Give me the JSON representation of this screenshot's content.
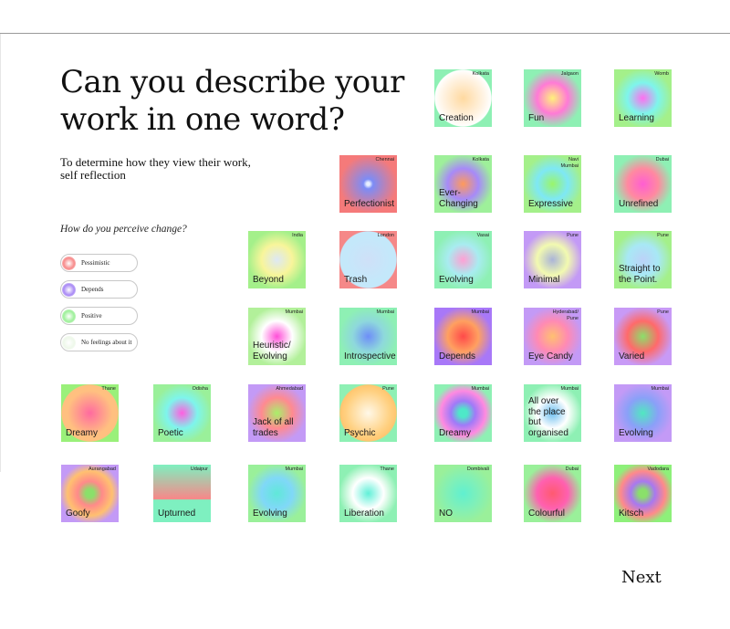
{
  "page": {
    "title": "Can you describe your work in one word?",
    "subtitle": "To determine how they view their work, self reflection",
    "next_label": "Next"
  },
  "legend": {
    "question": "How do you perceive change?",
    "items": [
      {
        "label": "Pessimistic",
        "color": "#f78a8a"
      },
      {
        "label": "Depends",
        "color": "#a98af5"
      },
      {
        "label": "Positive",
        "color": "#9ef09a"
      },
      {
        "label": "No feelings about it",
        "color": "#eef8ea"
      }
    ]
  },
  "tiles": [
    {
      "word": "Creation",
      "city": "Kolkata",
      "bg": "#8ef0b4",
      "center": "#ffd9a0",
      "mid": "#fff6ea",
      "edge": "#ffffff",
      "style": "disc"
    },
    {
      "word": "Fun",
      "city": "Jalgaon",
      "bg": "#8ef0b4",
      "center": "#fff27a",
      "mid": "#ff7ad6",
      "edge": "#8ef0b4",
      "style": "glow"
    },
    {
      "word": "Learning",
      "city": "Womb",
      "bg": "#a4f08a",
      "center": "#ff6ef0",
      "mid": "#7ef5ec",
      "edge": "#a4f08a",
      "style": "glow"
    },
    {
      "word": "Perfectionist",
      "city": "Chennai",
      "bg": "#f57a7a",
      "center": "#e8f0ff",
      "mid": "#7c8cf6",
      "edge": "#f57a7a",
      "style": "dot"
    },
    {
      "word": "Ever-\nChanging",
      "city": "Kolkata",
      "bg": "#9ef09a",
      "center": "#ff9a5a",
      "mid": "#a78af8",
      "edge": "#9ef09a",
      "style": "glow"
    },
    {
      "word": "Expressive",
      "city": "Navi\nMumbai",
      "bg": "#a4f08a",
      "center": "#9af56a",
      "mid": "#7ee8f5",
      "edge": "#a4f08a",
      "style": "glow"
    },
    {
      "word": "Unrefined",
      "city": "Dubai",
      "bg": "#8ef0b4",
      "center": "#ff5ed2",
      "mid": "#ff8aa0",
      "edge": "#8ef0b4",
      "style": "glow"
    },
    {
      "word": "Beyond",
      "city": "India",
      "bg": "#a4f08a",
      "center": "#dde8f5",
      "mid": "#f8f59a",
      "edge": "#a4f08a",
      "style": "glow"
    },
    {
      "word": "Trash",
      "city": "London",
      "bg": "#f58888",
      "center": "#cfe0f8",
      "mid": "#c4e8fa",
      "edge": "#c4e8fa",
      "style": "disc"
    },
    {
      "word": "Evolving",
      "city": "Vasai",
      "bg": "#8ef0b4",
      "center": "#ffa0d4",
      "mid": "#a8ecf0",
      "edge": "#8ef0b4",
      "style": "glow"
    },
    {
      "word": "Minimal",
      "city": "Pune",
      "bg": "#c39af6",
      "center": "#aab4d8",
      "mid": "#f2fab0",
      "edge": "#c39af6",
      "style": "glow"
    },
    {
      "word": "Straight to\nthe Point.",
      "city": "Pune",
      "bg": "#a4f08a",
      "center": "#bcd2f8",
      "mid": "#a8e8f5",
      "edge": "#a4f08a",
      "style": "glow"
    },
    {
      "word": "Heuristic/\nEvolving",
      "city": "Mumbai",
      "bg": "#b2f09a",
      "center": "#ff4ed8",
      "mid": "#ffffff",
      "edge": "#b2f09a",
      "style": "glow"
    },
    {
      "word": "Introspective",
      "city": "Mumbai",
      "bg": "#8ef0b4",
      "center": "#6e8ef8",
      "mid": "#8ed8dc",
      "edge": "#8ef0b4",
      "style": "glow"
    },
    {
      "word": "Depends",
      "city": "Mumbai",
      "bg": "#a878f8",
      "center": "#ff4a4a",
      "mid": "#ffa060",
      "edge": "#a878f8",
      "style": "glow"
    },
    {
      "word": "Eye Candy",
      "city": "Hyderabad/\nPune",
      "bg": "#c39af6",
      "center": "#ffc070",
      "mid": "#ff8ab4",
      "edge": "#c39af6",
      "style": "glow"
    },
    {
      "word": "Varied",
      "city": "Pune",
      "bg": "#c89af6",
      "center": "#8ae06a",
      "mid": "#ff6a6a",
      "edge": "#c89af6",
      "style": "glow"
    },
    {
      "word": "Dreamy",
      "city": "Thane",
      "bg": "#9af07a",
      "center": "#ff6aa0",
      "mid": "#ffc080",
      "edge": "#ffc080",
      "style": "disc"
    },
    {
      "word": "Poetic",
      "city": "Odisha",
      "bg": "#9af09a",
      "center": "#ff5ee0",
      "mid": "#7ef5ec",
      "edge": "#9af09a",
      "style": "glow"
    },
    {
      "word": "Jack of all\ntrades",
      "city": "Ahmedabad",
      "bg": "#c39af6",
      "center": "#a8f06a",
      "mid": "#ff8a90",
      "edge": "#c39af6",
      "style": "glow"
    },
    {
      "word": "Psychic",
      "city": "Pune",
      "bg": "#8ef0b4",
      "center": "#fff8e8",
      "mid": "#ffd080",
      "edge": "#ffc670",
      "style": "disc"
    },
    {
      "word": "Dreamy",
      "city": "Mumbai",
      "bg": "#8ef0b4",
      "center": "#4ee8c8",
      "mid": "#a07af8",
      "edge": "#ff8ae0",
      "style": "ring"
    },
    {
      "word": "All over\nthe place\nbut\norganised",
      "city": "Mumbai",
      "bg": "#8ef0b4",
      "center": "#6ec0f0",
      "mid": "#ffffff",
      "edge": "#8ef0b4",
      "style": "glow"
    },
    {
      "word": "Evolving",
      "city": "Mumbai",
      "bg": "#c39af6",
      "center": "#50e8c0",
      "mid": "#8aa0f8",
      "edge": "#c39af6",
      "style": "glow"
    },
    {
      "word": "Goofy",
      "city": "Aurangabad",
      "bg": "#c39af6",
      "center": "#8ae06a",
      "mid": "#ff8a8a",
      "edge": "#ffc070",
      "style": "ring"
    },
    {
      "word": "Upturned",
      "city": "Udaipur",
      "bg": "#7ef0c0",
      "center": "#f58a8a",
      "mid": "#7ef0c0",
      "edge": "#7ef0c0",
      "style": "split"
    },
    {
      "word": "Evolving",
      "city": "Mumbai",
      "bg": "#9af09a",
      "center": "#60e8d8",
      "mid": "#80d8f8",
      "edge": "#9af09a",
      "style": "glow"
    },
    {
      "word": "Liberation",
      "city": "Thane",
      "bg": "#8ef0b4",
      "center": "#60f0d8",
      "mid": "#ffffff",
      "edge": "#8ef0b4",
      "style": "glow"
    },
    {
      "word": "NO",
      "city": "Dombivali",
      "bg": "#9af09a",
      "center": "#60f0d0",
      "mid": "#80f0b8",
      "edge": "#9af09a",
      "style": "glow"
    },
    {
      "word": "Colourful",
      "city": "Dubai",
      "bg": "#9af09a",
      "center": "#ff5a70",
      "mid": "#ff60b0",
      "edge": "#9af09a",
      "style": "glow"
    },
    {
      "word": "Kitsch",
      "city": "Vadodara",
      "bg": "#8ef07a",
      "center": "#8ae06a",
      "mid": "#a878f0",
      "edge": "#ff8a8a",
      "style": "ring"
    }
  ]
}
